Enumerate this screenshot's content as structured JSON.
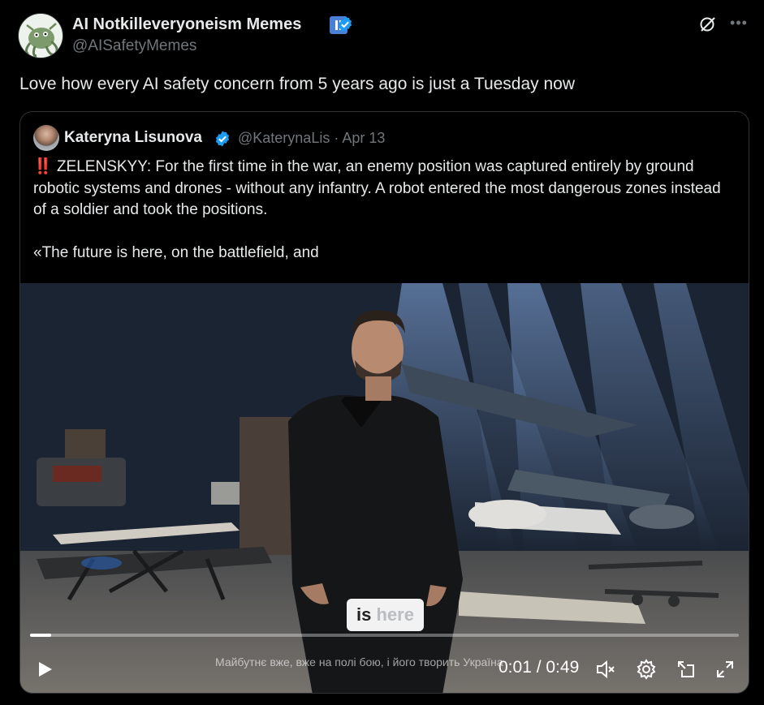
{
  "post": {
    "author_name": "AI Notkilleveryoneism Memes",
    "author_handle": "@AISafetyMemes",
    "text": "Love how every AI safety concern from 5 years ago is just a Tuesday now"
  },
  "quoted_post": {
    "author_name": "Kateryna Lisunova",
    "author_handle_date": "@KaterynaLis · Apr 13",
    "emoji": "‼️",
    "text_p1": "ZELENSKYY: For the first time in the war, an enemy position was captured entirely by ground robotic systems and drones - without any infantry. A robot entered the most dangerous zones instead of a soldier and took the positions.",
    "text_p2": "«The future is here, on the battlefield, and"
  },
  "video": {
    "caption_word1": "is",
    "caption_word2": "here",
    "subtitle": "Майбутнє вже, вже на полі бою, і його творить Україна",
    "time": "0:01 / 0:49",
    "progress": 0.03
  },
  "icons": {
    "verified": "verified-badge-icon",
    "grok": "grok-icon",
    "more": "more-icon",
    "play": "play-icon",
    "mute": "mute-icon",
    "settings": "settings-icon",
    "popout": "popout-icon",
    "fullscreen": "fullscreen-icon"
  },
  "colors": {
    "verified_blue": "#1d9bf0",
    "pause_badge": "#4a7fd6",
    "muted_text": "#71767b"
  }
}
